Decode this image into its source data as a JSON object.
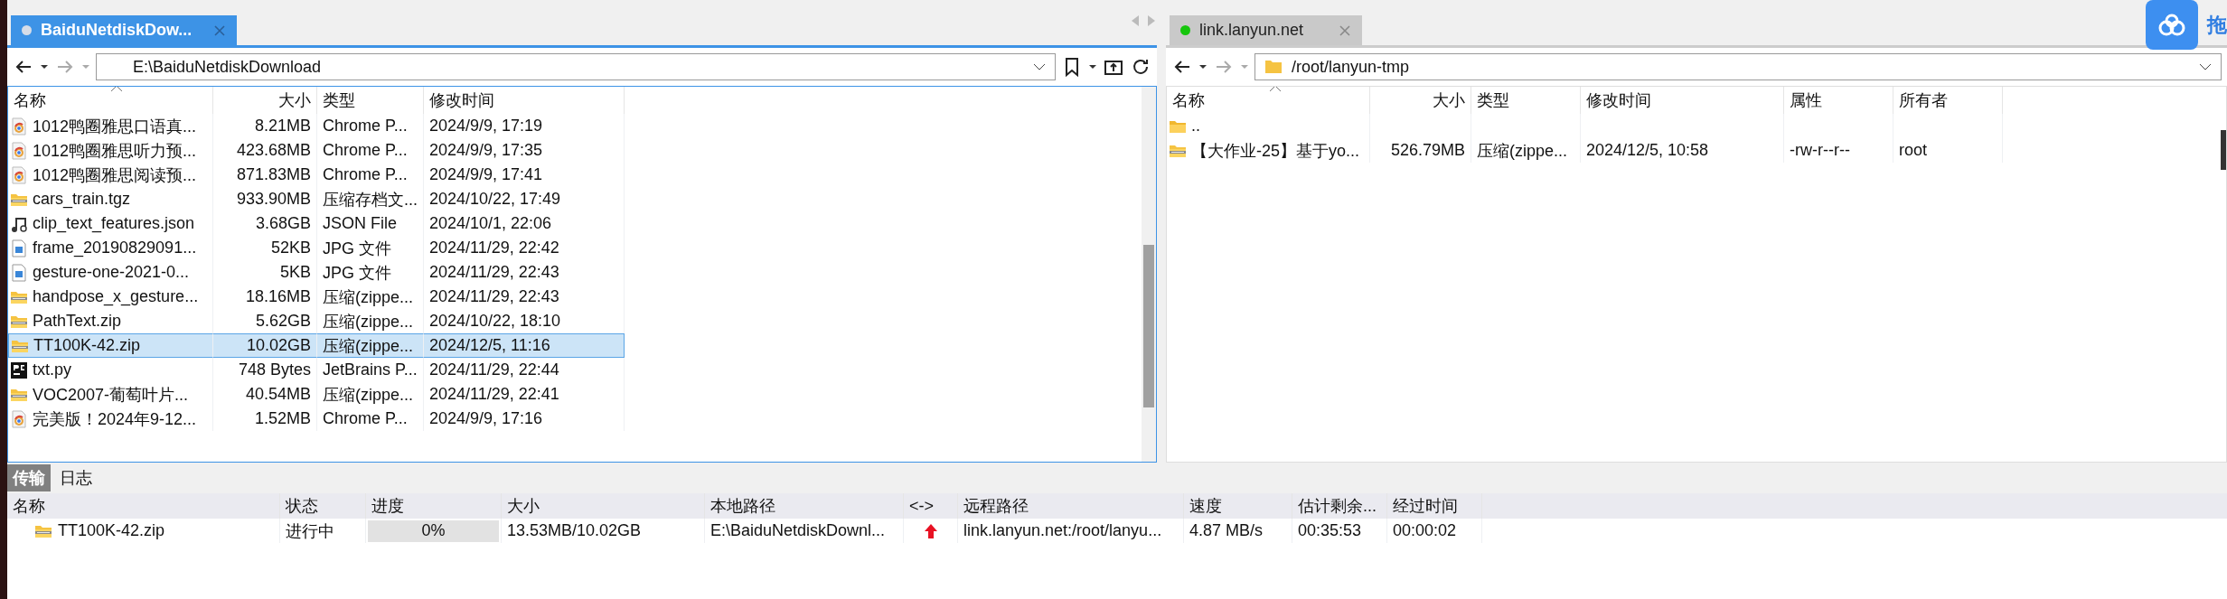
{
  "left_pane": {
    "tab": {
      "title": "BaiduNetdiskDow...",
      "selected": true,
      "color": "#d6dde8"
    },
    "path": "E:\\BaiduNetdiskDownload",
    "columns": [
      "名称",
      "大小",
      "类型",
      "修改时间"
    ],
    "files": [
      {
        "kind": "chrome",
        "name": "1012鸭圈雅思口语真...",
        "size": "8.21MB",
        "type": "Chrome P...",
        "modified": "2024/9/9, 17:19",
        "selected": false
      },
      {
        "kind": "chrome",
        "name": "1012鸭圈雅思听力预...",
        "size": "423.68MB",
        "type": "Chrome P...",
        "modified": "2024/9/9, 17:35",
        "selected": false
      },
      {
        "kind": "chrome",
        "name": "1012鸭圈雅思阅读预...",
        "size": "871.83MB",
        "type": "Chrome P...",
        "modified": "2024/9/9, 17:41",
        "selected": false
      },
      {
        "kind": "zip",
        "name": "cars_train.tgz",
        "size": "933.90MB",
        "type": "压缩存档文...",
        "modified": "2024/10/22, 17:49",
        "selected": false
      },
      {
        "kind": "json",
        "name": "clip_text_features.json",
        "size": "3.68GB",
        "type": "JSON File",
        "modified": "2024/10/1, 22:06",
        "selected": false
      },
      {
        "kind": "image",
        "name": "frame_20190829091...",
        "size": "52KB",
        "type": "JPG 文件",
        "modified": "2024/11/29, 22:42",
        "selected": false
      },
      {
        "kind": "image",
        "name": "gesture-one-2021-0...",
        "size": "5KB",
        "type": "JPG 文件",
        "modified": "2024/11/29, 22:43",
        "selected": false
      },
      {
        "kind": "zip",
        "name": "handpose_x_gesture...",
        "size": "18.16MB",
        "type": "压缩(zippe...",
        "modified": "2024/11/29, 22:43",
        "selected": false
      },
      {
        "kind": "zip",
        "name": "PathText.zip",
        "size": "5.62GB",
        "type": "压缩(zippe...",
        "modified": "2024/10/22, 18:10",
        "selected": false
      },
      {
        "kind": "zip",
        "name": "TT100K-42.zip",
        "size": "10.02GB",
        "type": "压缩(zippe...",
        "modified": "2024/12/5, 11:16",
        "selected": true
      },
      {
        "kind": "pycharm",
        "name": "txt.py",
        "size": "748 Bytes",
        "type": "JetBrains P...",
        "modified": "2024/11/29, 22:44",
        "selected": false
      },
      {
        "kind": "zip",
        "name": "VOC2007-葡萄叶片...",
        "size": "40.54MB",
        "type": "压缩(zippe...",
        "modified": "2024/11/29, 22:41",
        "selected": false
      },
      {
        "kind": "chrome",
        "name": "完美版！2024年9-12...",
        "size": "1.52MB",
        "type": "Chrome P...",
        "modified": "2024/9/9, 17:16",
        "selected": false
      }
    ]
  },
  "right_pane": {
    "tab": {
      "title": "link.lanyun.net",
      "selected": false,
      "color": "#16c60c"
    },
    "path": "/root/lanyun-tmp",
    "columns": [
      "名称",
      "大小",
      "类型",
      "修改时间",
      "属性",
      "所有者"
    ],
    "files": [
      {
        "kind": "folder",
        "name": "..",
        "selected": false
      },
      {
        "kind": "zip",
        "name": "【大作业-25】基于yo...",
        "size": "526.79MB",
        "type": "压缩(zippe...",
        "modified": "2024/12/5, 10:58",
        "attributes": "-rw-r--r--",
        "owner": "root",
        "selected": false
      }
    ]
  },
  "corner": {
    "text": "拖"
  },
  "bottom": {
    "tabs": [
      {
        "label": "传输",
        "selected": true
      },
      {
        "label": "日志",
        "selected": false
      }
    ],
    "columns": [
      "名称",
      "状态",
      "进度",
      "大小",
      "本地路径",
      "<->",
      "远程路径",
      "速度",
      "估计剩余...",
      "经过时间"
    ],
    "transfers": [
      {
        "name": "TT100K-42.zip",
        "status": "进行中",
        "level": 0,
        "progress": "0%",
        "size": "13.53MB/10.02GB",
        "local": "E:\\BaiduNetdiskDownl...",
        "remote": "link.lanyun.net:/root/lanyu...",
        "speed": "4.87 MB/s",
        "remaining": "00:35:53",
        "elapsed": "00:00:02"
      }
    ]
  }
}
